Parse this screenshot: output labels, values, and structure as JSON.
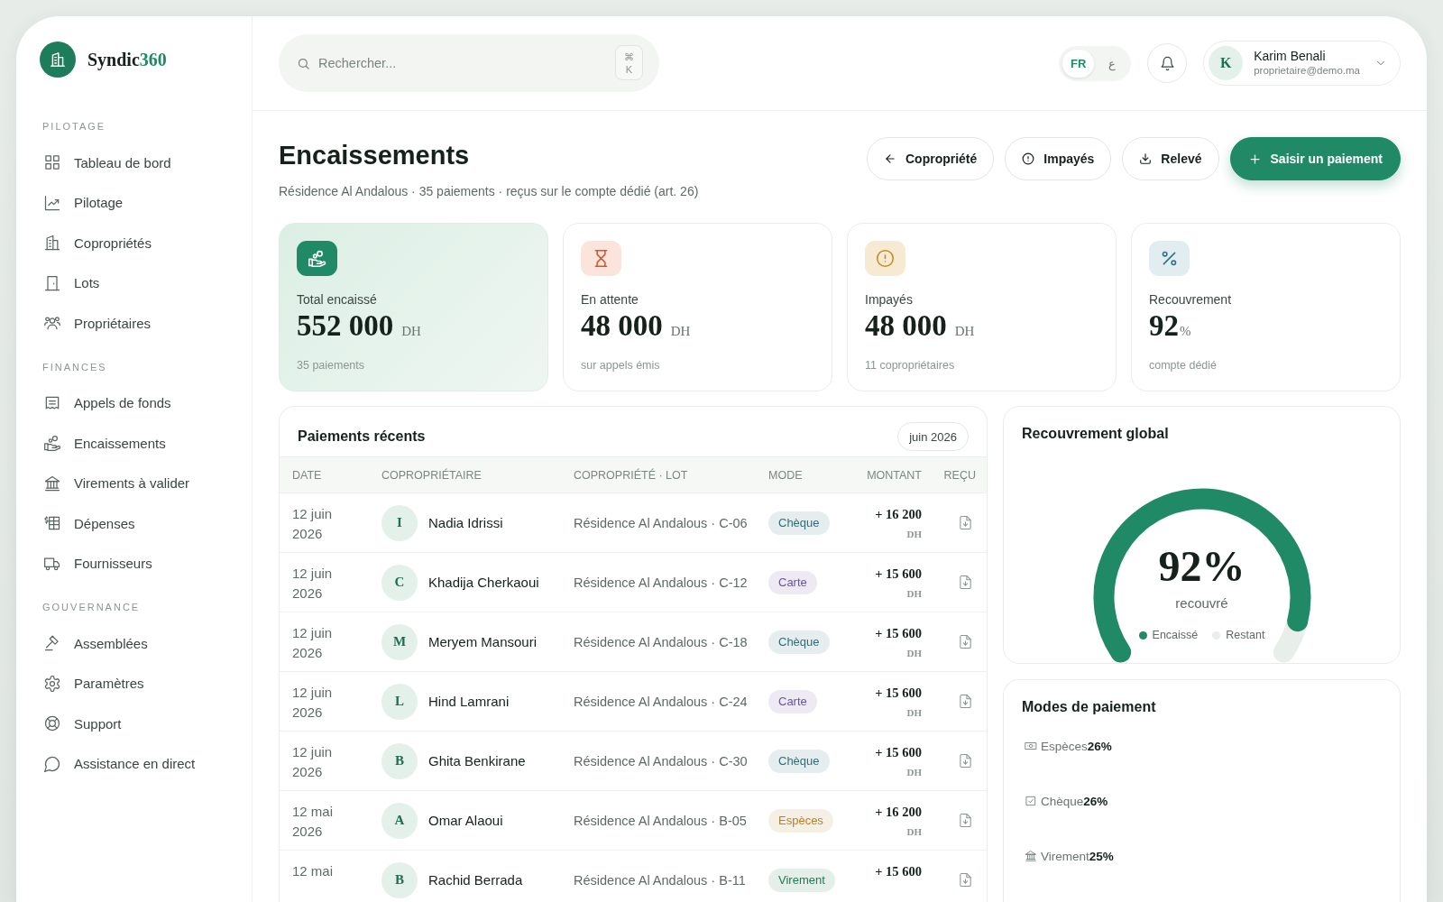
{
  "brand": {
    "name": "Syndic",
    "accent": "360"
  },
  "sidebar": {
    "sections": [
      {
        "title": "PILOTAGE",
        "items": [
          {
            "label": "Tableau de bord"
          },
          {
            "label": "Pilotage"
          },
          {
            "label": "Copropriétés"
          },
          {
            "label": "Lots"
          },
          {
            "label": "Propriétaires"
          }
        ]
      },
      {
        "title": "FINANCES",
        "items": [
          {
            "label": "Appels de fonds"
          },
          {
            "label": "Encaissements"
          },
          {
            "label": "Virements à valider"
          },
          {
            "label": "Dépenses"
          },
          {
            "label": "Fournisseurs"
          }
        ]
      },
      {
        "title": "GOUVERNANCE",
        "items": [
          {
            "label": "Assemblées"
          },
          {
            "label": "Paramètres"
          },
          {
            "label": "Support"
          },
          {
            "label": "Assistance en direct"
          }
        ]
      }
    ]
  },
  "topbar": {
    "search": {
      "placeholder": "Rechercher...",
      "shortcut": [
        "⌘",
        "K"
      ]
    },
    "languages": [
      {
        "label": "FR",
        "selected": true
      },
      {
        "label": "ع",
        "selected": false
      }
    ],
    "user": {
      "initial": "K",
      "name": "Karim Benali",
      "email": "proprietaire@demo.ma"
    }
  },
  "header": {
    "title": "Encaissements",
    "subtitle": "Résidence Al Andalous · 35 paiements · reçus sur le compte dédié (art. 26)",
    "actions": [
      {
        "label": "Copropriété",
        "kind": "back"
      },
      {
        "label": "Impayés",
        "kind": "alert"
      },
      {
        "label": "Relevé",
        "kind": "download"
      },
      {
        "label": "Saisir un paiement",
        "kind": "add"
      }
    ]
  },
  "stats": [
    {
      "kind": "total",
      "label": "Total encaissé",
      "value": "552 000",
      "unit": "DH",
      "note": "35 paiements"
    },
    {
      "kind": "pending",
      "label": "En attente",
      "value": "48 000",
      "unit": "DH",
      "note": "sur appels émis"
    },
    {
      "kind": "unpaid",
      "label": "Impayés",
      "value": "48 000",
      "unit": "DH",
      "note": "11 copropriétaires"
    },
    {
      "kind": "rate",
      "label": "Recouvrement",
      "value": "92",
      "unit": "%",
      "note": "compte dédié"
    }
  ],
  "payments": {
    "title": "Paiements récents",
    "period": "juin 2026",
    "columns": [
      "DATE",
      "COPROPRIÉTAIRE",
      "COPROPRIÉTÉ · LOT",
      "MODE",
      "MONTANT",
      "REÇU"
    ],
    "rows": [
      {
        "date": "12 juin 2026",
        "initial": "I",
        "name": "Nadia Idrissi",
        "property": "Résidence Al Andalous · C-06",
        "mode": {
          "label": "Chèque",
          "color": "#2c6e7a"
        },
        "amount": "+ 16 200",
        "currency": "DH"
      },
      {
        "date": "12 juin 2026",
        "initial": "C",
        "name": "Khadija Cherkaoui",
        "property": "Résidence Al Andalous · C-12",
        "mode": {
          "label": "Carte",
          "color": "#6a52a8"
        },
        "amount": "+ 15 600",
        "currency": "DH"
      },
      {
        "date": "12 juin 2026",
        "initial": "M",
        "name": "Meryem Mansouri",
        "property": "Résidence Al Andalous · C-18",
        "mode": {
          "label": "Chèque",
          "color": "#2c6e7a"
        },
        "amount": "+ 15 600",
        "currency": "DH"
      },
      {
        "date": "12 juin 2026",
        "initial": "L",
        "name": "Hind Lamrani",
        "property": "Résidence Al Andalous · C-24",
        "mode": {
          "label": "Carte",
          "color": "#6a52a8"
        },
        "amount": "+ 15 600",
        "currency": "DH"
      },
      {
        "date": "12 juin 2026",
        "initial": "B",
        "name": "Ghita Benkirane",
        "property": "Résidence Al Andalous · C-30",
        "mode": {
          "label": "Chèque",
          "color": "#2c6e7a"
        },
        "amount": "+ 15 600",
        "currency": "DH"
      },
      {
        "date": "12 mai 2026",
        "initial": "A",
        "name": "Omar Alaoui",
        "property": "Résidence Al Andalous · B-05",
        "mode": {
          "label": "Espèces",
          "color": "#b58125"
        },
        "amount": "+ 16 200",
        "currency": "DH"
      },
      {
        "date": "12 mai",
        "initial": "B",
        "name": "Rachid Berrada",
        "property": "Résidence Al Andalous · B-11",
        "mode": {
          "label": "Virement",
          "color": "#1f7a55"
        },
        "amount": "+ 15 600"
      }
    ]
  },
  "recovery": {
    "title": "Recouvrement global",
    "value": "92%",
    "caption": "recouvré",
    "legend": [
      {
        "label": "Encaissé",
        "color": "#1f8a65"
      },
      {
        "label": "Restant",
        "color": "#e8eee9"
      }
    ]
  },
  "payment_modes": {
    "title": "Modes de paiement",
    "items": [
      {
        "label": "Espèces",
        "value": "26%"
      },
      {
        "label": "Chèque",
        "value": "26%"
      },
      {
        "label": "Virement",
        "value": "25%"
      }
    ]
  }
}
